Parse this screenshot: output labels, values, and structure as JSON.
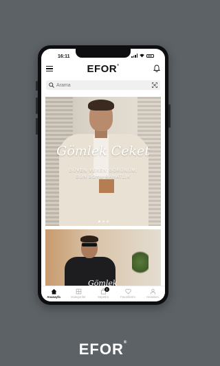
{
  "status_bar": {
    "time": "16:11"
  },
  "header": {
    "logo": "EFOR",
    "logo_mark": "®"
  },
  "search": {
    "placeholder": "Arama"
  },
  "hero": {
    "title": "Gömlek Ceket",
    "subtitle_line1": "GÜVEN VEREN GÖRÜNÜM,",
    "subtitle_line2": "GÜN BOYU RAHATLIK",
    "slides": 3,
    "active_slide": 1
  },
  "second_banner": {
    "title": "Gömlek"
  },
  "tabbar": {
    "items": [
      {
        "label": "Anasayfa",
        "icon": "home-icon",
        "active": true
      },
      {
        "label": "Kategoriler",
        "icon": "grid-icon",
        "active": false
      },
      {
        "label": "Sepetim",
        "icon": "bag-icon",
        "active": false,
        "badge": "1"
      },
      {
        "label": "Favorilerim",
        "icon": "heart-icon",
        "active": false
      },
      {
        "label": "Hesabım",
        "icon": "user-icon",
        "active": false
      }
    ]
  },
  "footer_brand": {
    "text": "EFOR",
    "mark": "®"
  },
  "colors": {
    "background": "#5c6266",
    "accent": "#111111"
  }
}
